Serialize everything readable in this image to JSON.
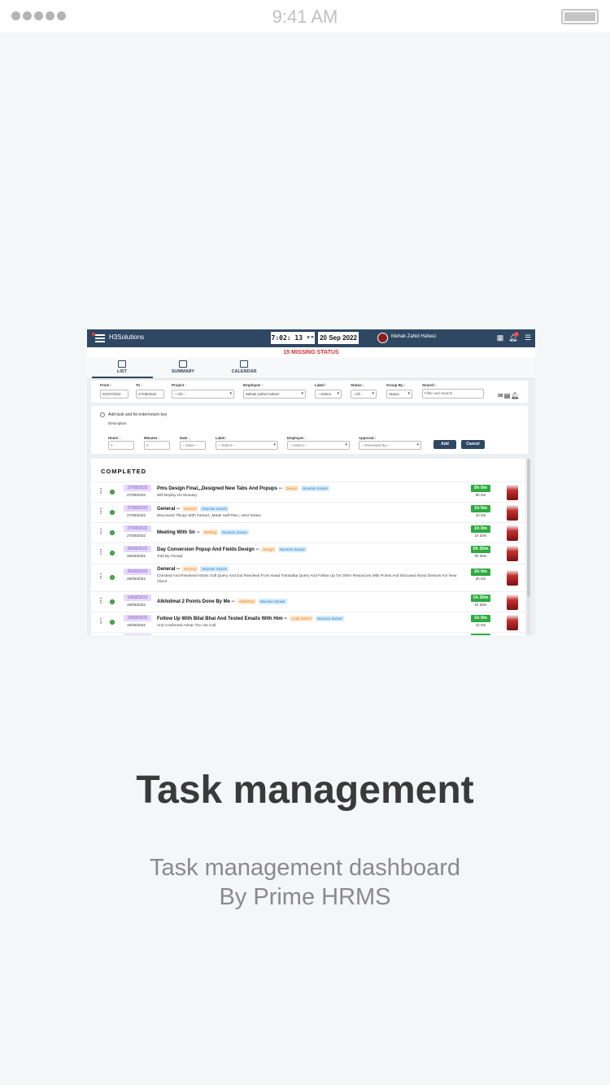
{
  "status_bar": {
    "time": "9:41 AM"
  },
  "app": {
    "brand": "H3Solutions",
    "clock": "7:02: 13 ᵖᵐ",
    "date": "20 Sep 2022",
    "user": "Mehak Zahid Hafeez",
    "notification_count": "0",
    "missing_status": "15 MISSING STATUS",
    "view_tabs": [
      "LIST",
      "SUMMARY",
      "CALENDAR"
    ],
    "filters": {
      "from_label": "From :",
      "from_value": "01/07/2022",
      "to_label": "To :",
      "to_value": "27/08/2022",
      "project_label": "Project :",
      "project_value": "---All---",
      "employee_label": "Employee :",
      "employee_value": "Mehak Zahid Hafeez",
      "label_label": "Label :",
      "label_value": "---Select",
      "status_label": "Status :",
      "status_value": "--All--",
      "groupby_label": "Group By :",
      "groupby_value": "Status",
      "search_label": "Search :",
      "search_placeholder": "Filter and Search"
    },
    "add_task": {
      "prompt": "Add task and hit enter/return key",
      "description_label": "Description",
      "hours_label": "Hours :",
      "hours_value": "0",
      "minutes_label": "Minutes :",
      "minutes_value": "0",
      "date_label": "Date :",
      "date_value": "---Date---",
      "label_label": "Label :",
      "label_value": "---Select---",
      "employee_label": "Employee :",
      "employee_value": "---Select---",
      "approval_label": "Approval :",
      "approval_value": "---Reviewed By---",
      "add_button": "Add",
      "cancel_button": "Cancel"
    },
    "section_title": "COMPLETED",
    "tasks": [
      {
        "chip": "27/08/2022",
        "date": "27/08/2022",
        "title": "Pms Design Final,,,Designed New Tabs And Popups --",
        "tag1": "Design",
        "tag2": "Nouman Sarwar",
        "desc": "Will Deploy On Monday",
        "duration": "5h 0m",
        "duration_sub": "5h 0m"
      },
      {
        "chip": "27/08/2022",
        "date": "27/08/2022",
        "title": "General --",
        "tag1": "General",
        "tag2": "Nouman Sarwar",
        "desc": "Discussed Things With Fareed,,,Made Half Plan,,,Sent Status",
        "duration": "1h 0m",
        "duration_sub": "1h 0m"
      },
      {
        "chip": "27/08/2022",
        "date": "27/08/2022",
        "title": "Meeting With Sir --",
        "tag1": "Meeting",
        "tag2": "Nouman Sarwar",
        "desc": "",
        "duration": "1h 0m",
        "duration_sub": "1h 30m"
      },
      {
        "chip": "26/08/2022",
        "date": "26/08/2022",
        "title": "Day Conversion Popup And Fields Design --",
        "tag1": "Design",
        "tag2": "Nouman Sarwar",
        "desc": "Told By Ahmad",
        "duration": "0h 30m",
        "duration_sub": "0h 30m"
      },
      {
        "chip": "25/08/2022",
        "date": "25/08/2022",
        "title": "General --",
        "tag1": "General",
        "tag2": "Nouman Sarwar",
        "desc": "Checked And Resolved Arham Soft Query And Got Resolved From Haad Transdata Query And Follow Up On Other Resources With Points And Discused About Devices For New Client",
        "duration": "2h 0m",
        "duration_sub": "2h 0m"
      },
      {
        "chip": "19/08/2022",
        "date": "19/08/2022",
        "title": "Alkhidmat 2 Points Done By Me --",
        "tag1": "Alkhidmat",
        "tag2": "Nouman Sarwar",
        "desc": "",
        "duration": "1h 30m",
        "duration_sub": "1h 30m"
      },
      {
        "chip": "19/08/2022",
        "date": "19/08/2022",
        "title": "Follow Up With Bilal Bhai And Tested Emails With Him --",
        "tag1": "Code District",
        "tag2": "Nouman Sarwar",
        "desc": "And Confirmed Adnan Too Via Call",
        "duration": "1h 0m",
        "duration_sub": "1h 0m"
      }
    ]
  },
  "headline": "Task management",
  "subtitle_line1": "Task management dashboard",
  "subtitle_line2": "By Prime HRMS",
  "colors": {
    "header": "#2e4763",
    "missing": "#d32f2f",
    "duration": "#2eaa3f",
    "date_chip": "#e6d9fb"
  }
}
